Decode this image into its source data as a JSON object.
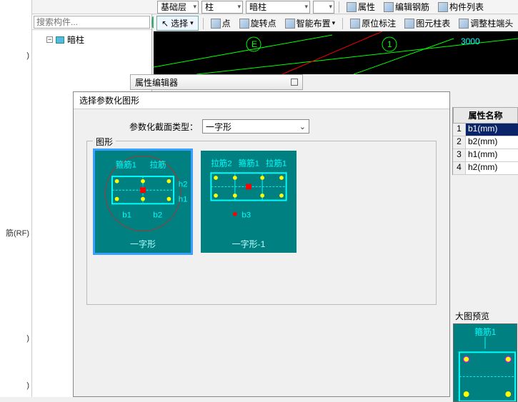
{
  "toolbar1": {
    "layer": "基础层",
    "cat": "柱",
    "sub": "暗柱",
    "prop": "属性",
    "rebar": "编辑钢筋",
    "list": "构件列表"
  },
  "toolbar2": {
    "select": "选择",
    "point": "点",
    "rotpoint": "旋转点",
    "smart": "智能布置",
    "origmark": "原位标注",
    "colTable": "图元柱表",
    "adjEnd": "调整柱端头"
  },
  "farleft": {
    "a": ")",
    "b": "筋(RF)",
    "c": ")",
    "d": ")"
  },
  "search": {
    "placeholder": "搜索构件..."
  },
  "tree": {
    "item1": "暗柱"
  },
  "canvas": {
    "labelE": "E",
    "label1": "1",
    "dim": "3000"
  },
  "propEditor": {
    "title": "属性编辑器"
  },
  "dialog": {
    "title": "选择参数化图形",
    "typeLabel": "参数化截面类型：",
    "typeValue": "一字形",
    "groupTitle": "图形",
    "thumbs": [
      {
        "caption": "一字形",
        "labels": {
          "gj": "箍筋1",
          "lj": "拉筋",
          "b1": "b1",
          "b2": "b2",
          "h1": "h1",
          "h2": "h2"
        }
      },
      {
        "caption": "一字形-1",
        "labels": {
          "lj1": "拉筋1",
          "lj2": "拉筋2",
          "gj": "箍筋1",
          "b3": "b3"
        }
      }
    ]
  },
  "props": {
    "head": "属性名称",
    "rows": [
      {
        "i": "1",
        "v": "b1(mm)"
      },
      {
        "i": "2",
        "v": "b2(mm)"
      },
      {
        "i": "3",
        "v": "h1(mm)"
      },
      {
        "i": "4",
        "v": "h2(mm)"
      }
    ]
  },
  "preview": {
    "title": "大图预览",
    "label": "箍筋1"
  }
}
